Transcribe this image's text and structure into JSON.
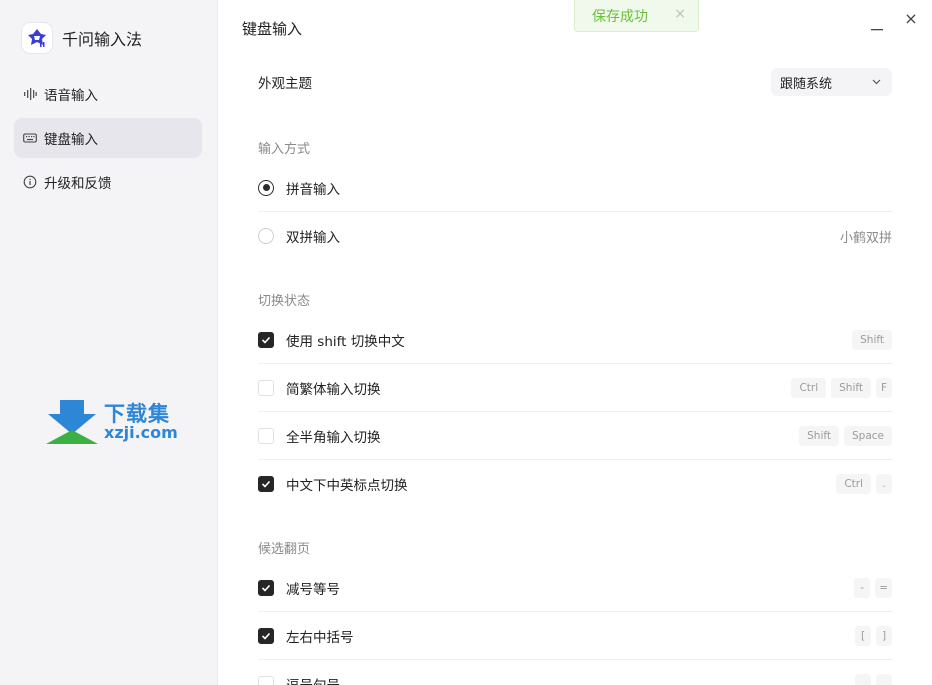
{
  "app": {
    "name": "千问输入法"
  },
  "sidebar": {
    "items": [
      {
        "label": "语音输入",
        "icon": "waveform-icon",
        "active": false
      },
      {
        "label": "键盘输入",
        "icon": "keyboard-icon",
        "active": true
      },
      {
        "label": "升级和反馈",
        "icon": "info-icon",
        "active": false
      }
    ]
  },
  "watermark": {
    "line1": "下载集",
    "line2": "xzji.com"
  },
  "header": {
    "title": "键盘输入"
  },
  "toast": {
    "message": "保存成功",
    "close": "×"
  },
  "window": {
    "close": "×"
  },
  "appearance": {
    "label": "外观主题",
    "value": "跟随系统"
  },
  "input_method": {
    "title": "输入方式",
    "options": [
      {
        "label": "拼音输入",
        "selected": true,
        "extra": ""
      },
      {
        "label": "双拼输入",
        "selected": false,
        "extra": "小鹤双拼"
      }
    ]
  },
  "switch_state": {
    "title": "切换状态",
    "items": [
      {
        "label": "使用 shift 切换中文",
        "checked": true,
        "keys": [
          "Shift"
        ]
      },
      {
        "label": "简繁体输入切换",
        "checked": false,
        "keys": [
          "Ctrl",
          "Shift",
          "F"
        ]
      },
      {
        "label": "全半角输入切换",
        "checked": false,
        "keys": [
          "Shift",
          "Space"
        ]
      },
      {
        "label": "中文下中英标点切换",
        "checked": true,
        "keys": [
          "Ctrl",
          "."
        ]
      }
    ]
  },
  "candidate_paging": {
    "title": "候选翻页",
    "items": [
      {
        "label": "减号等号",
        "checked": true,
        "keys": [
          "-",
          "="
        ]
      },
      {
        "label": "左右中括号",
        "checked": true,
        "keys": [
          "[",
          "]"
        ]
      },
      {
        "label": "逗号句号",
        "checked": false,
        "keys": [
          ",",
          "."
        ]
      }
    ]
  },
  "colors": {
    "accent": "#262626",
    "toast_green": "#67c23a",
    "sidebar_bg": "#f4f4f7",
    "watermark_blue": "#2d86d6",
    "watermark_green": "#3cb043"
  }
}
